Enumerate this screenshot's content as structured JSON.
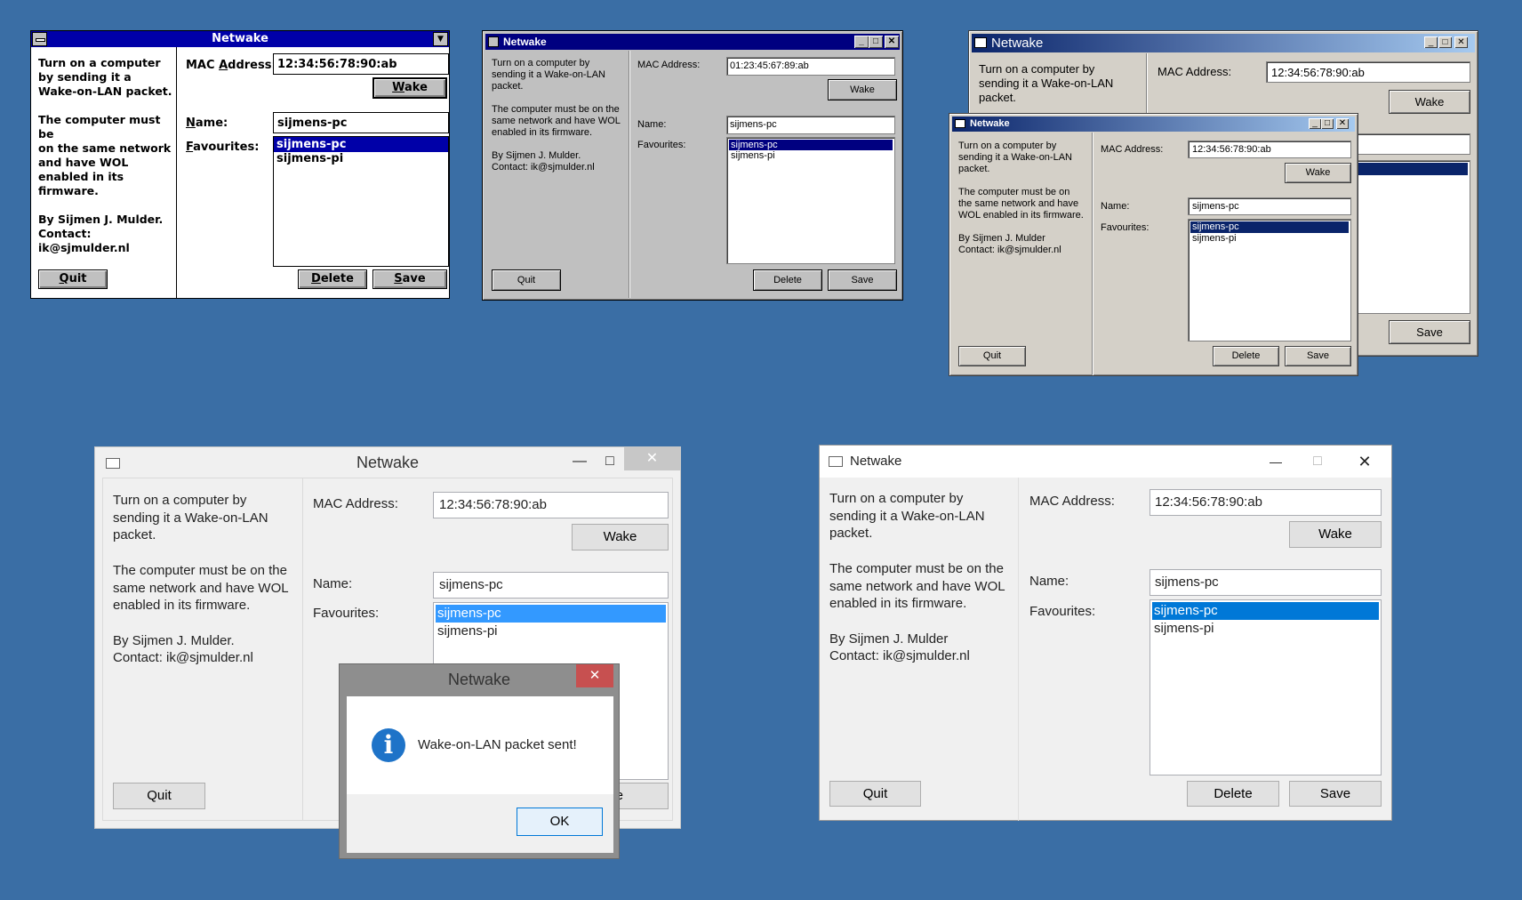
{
  "app": {
    "title": "Netwake",
    "description": "Turn on a computer by sending it a Wake-on-LAN packet.",
    "requirement": "The computer must be on the same network and have WOL enabled in its firmware.",
    "author_dot": "By Sijmen J. Mulder.",
    "author_nodot": "By Sijmen J. Mulder",
    "contact": "Contact: ik@sjmulder.nl",
    "mac_label": "MAC Address:",
    "name_label": "Name:",
    "favs_label": "Favourites:",
    "wake": "Wake",
    "quit": "Quit",
    "delete": "Delete",
    "save": "Save",
    "mac_value": "12:34:56:78:90:ab",
    "mac_value_alt": "01:23:45:67:89:ab",
    "name_value": "sijmens-pc",
    "favourites": [
      "sijmens-pc",
      "sijmens-pi"
    ]
  },
  "w31": {
    "info": "Turn on a computer\nby sending it a\nWake-on-LAN packet.\n\nThe computer must be\non the same network\nand have WOL\nenabled in its\nfirmware.\n\nBy Sijmen J. Mulder.\nContact:\nik@sjmulder.nl",
    "mac_label_a": "MAC ",
    "mac_label_b": "A",
    "mac_label_c": "ddress:",
    "name_label_a": "N",
    "name_label_b": "ame:",
    "favs_label_a": "F",
    "favs_label_b": "avourites:",
    "wake_a": "W",
    "wake_b": "ake",
    "quit_a": "Q",
    "quit_b": "uit",
    "delete_a": "D",
    "delete_b": "elete",
    "save_a": "S",
    "save_b": "ave"
  },
  "w95": {
    "info": "Turn on a computer by\nsending it a Wake-on-LAN\npacket.\n\nThe computer must be on the\nsame network and have WOL\nenabled in its firmware.\n\nBy Sijmen J. Mulder.\nContact: ik@sjmulder.nl"
  },
  "w2k": {
    "info": "Turn on a computer by\nsending it a Wake-on-LAN\npacket.\n\nThe computer must be on\nthe same network and have\nWOL enabled in its firmware.\n\nBy Sijmen J. Mulder\nContact: ik@sjmulder.nl",
    "back_info": "Turn on a computer by\nsending it a Wake-on-LAN\npacket."
  },
  "w8": {
    "info": "Turn on a computer by\nsending it a Wake-on-LAN\npacket.\n\nThe computer must be on the\nsame network and have WOL\nenabled in its firmware.\n\nBy Sijmen J. Mulder.\nContact: ik@sjmulder.nl",
    "dialog_title": "Netwake",
    "dialog_message": "Wake-on-LAN packet sent!",
    "dialog_ok": "OK",
    "partial_save": "ve"
  },
  "w10": {
    "info": "Turn on a computer by\nsending it a Wake-on-LAN\npacket.\n\nThe computer must be on the\nsame network and have WOL\nenabled in its firmware.\n\nBy Sijmen J. Mulder\nContact: ik@sjmulder.nl"
  },
  "icons": [
    "control-menu-icon",
    "minimize-icon",
    "maximize-icon",
    "close-icon",
    "info-icon",
    "app-icon"
  ],
  "colors": {
    "desktop": "#3a6ea5",
    "win31_title": "#0000a8",
    "win95_title": "#000080",
    "win8_close": "#c75050",
    "win10_selection": "#0078d7"
  }
}
